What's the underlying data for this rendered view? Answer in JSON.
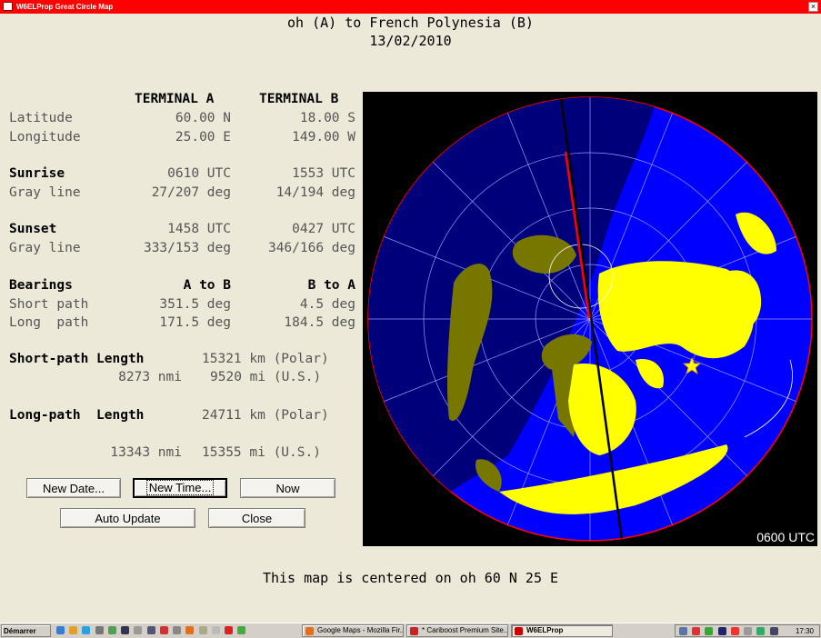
{
  "window": {
    "title": "W6ELProp Great Circle Map",
    "close_glyph": "×"
  },
  "header": {
    "title": "oh (A) to French Polynesia (B)",
    "date": "13/02/2010"
  },
  "table": {
    "col_a": "TERMINAL A",
    "col_b": "TERMINAL B",
    "latitude": {
      "label": "Latitude",
      "a": "60.00 N",
      "b": "18.00 S"
    },
    "longitude": {
      "label": "Longitude",
      "a": "25.00 E",
      "b": "149.00 W"
    },
    "sunrise": {
      "label": "Sunrise",
      "a": "0610 UTC",
      "b": "1553 UTC"
    },
    "sunrise_gray": {
      "label": "Gray line",
      "a": "27/207 deg",
      "b": "14/194 deg"
    },
    "sunset": {
      "label": "Sunset",
      "a": "1458 UTC",
      "b": "0427 UTC"
    },
    "sunset_gray": {
      "label": "Gray line",
      "a": "333/153 deg",
      "b": "346/166 deg"
    },
    "bearings": {
      "label": "Bearings",
      "a": "A to B",
      "b": "B to A"
    },
    "short_path": {
      "label": "Short path",
      "a": "351.5 deg",
      "b": "4.5 deg"
    },
    "long_path": {
      "label": "Long  path",
      "a": "171.5 deg",
      "b": "184.5 deg"
    }
  },
  "lengths": {
    "short_label": "Short-path Length",
    "short_km": "15321 km (Polar)",
    "short_nmi": "8273 nmi",
    "short_mi": "9520 mi (U.S.)",
    "long_label": "Long-path  Length",
    "long_km": "24711 km (Polar)",
    "long_nmi": "13343 nmi",
    "long_mi": "15355 mi (U.S.)"
  },
  "buttons": {
    "new_date": "New Date...",
    "new_time": "New Time...",
    "now": "Now",
    "auto_update": "Auto Update",
    "close": "Close"
  },
  "map": {
    "utc_label": "0600 UTC",
    "colors": {
      "ocean": "#0000ff",
      "land": "#ffff00",
      "night_land": "#777700",
      "night_ocean": "#00007a",
      "path_short": "#ff0000",
      "path": "#000000"
    }
  },
  "footer": "This map is centered on oh 60 N 25 E",
  "taskbar": {
    "start": "Démarrer",
    "tasks": [
      {
        "label": "Google Maps - Mozilla Fir...",
        "icon": "firefox-icon"
      },
      {
        "label": "* Cariboost Premium Site...",
        "icon": "cariboost-icon"
      },
      {
        "label": "W6ELProp",
        "icon": "w6elprop-icon"
      }
    ],
    "clock": "17:30"
  }
}
